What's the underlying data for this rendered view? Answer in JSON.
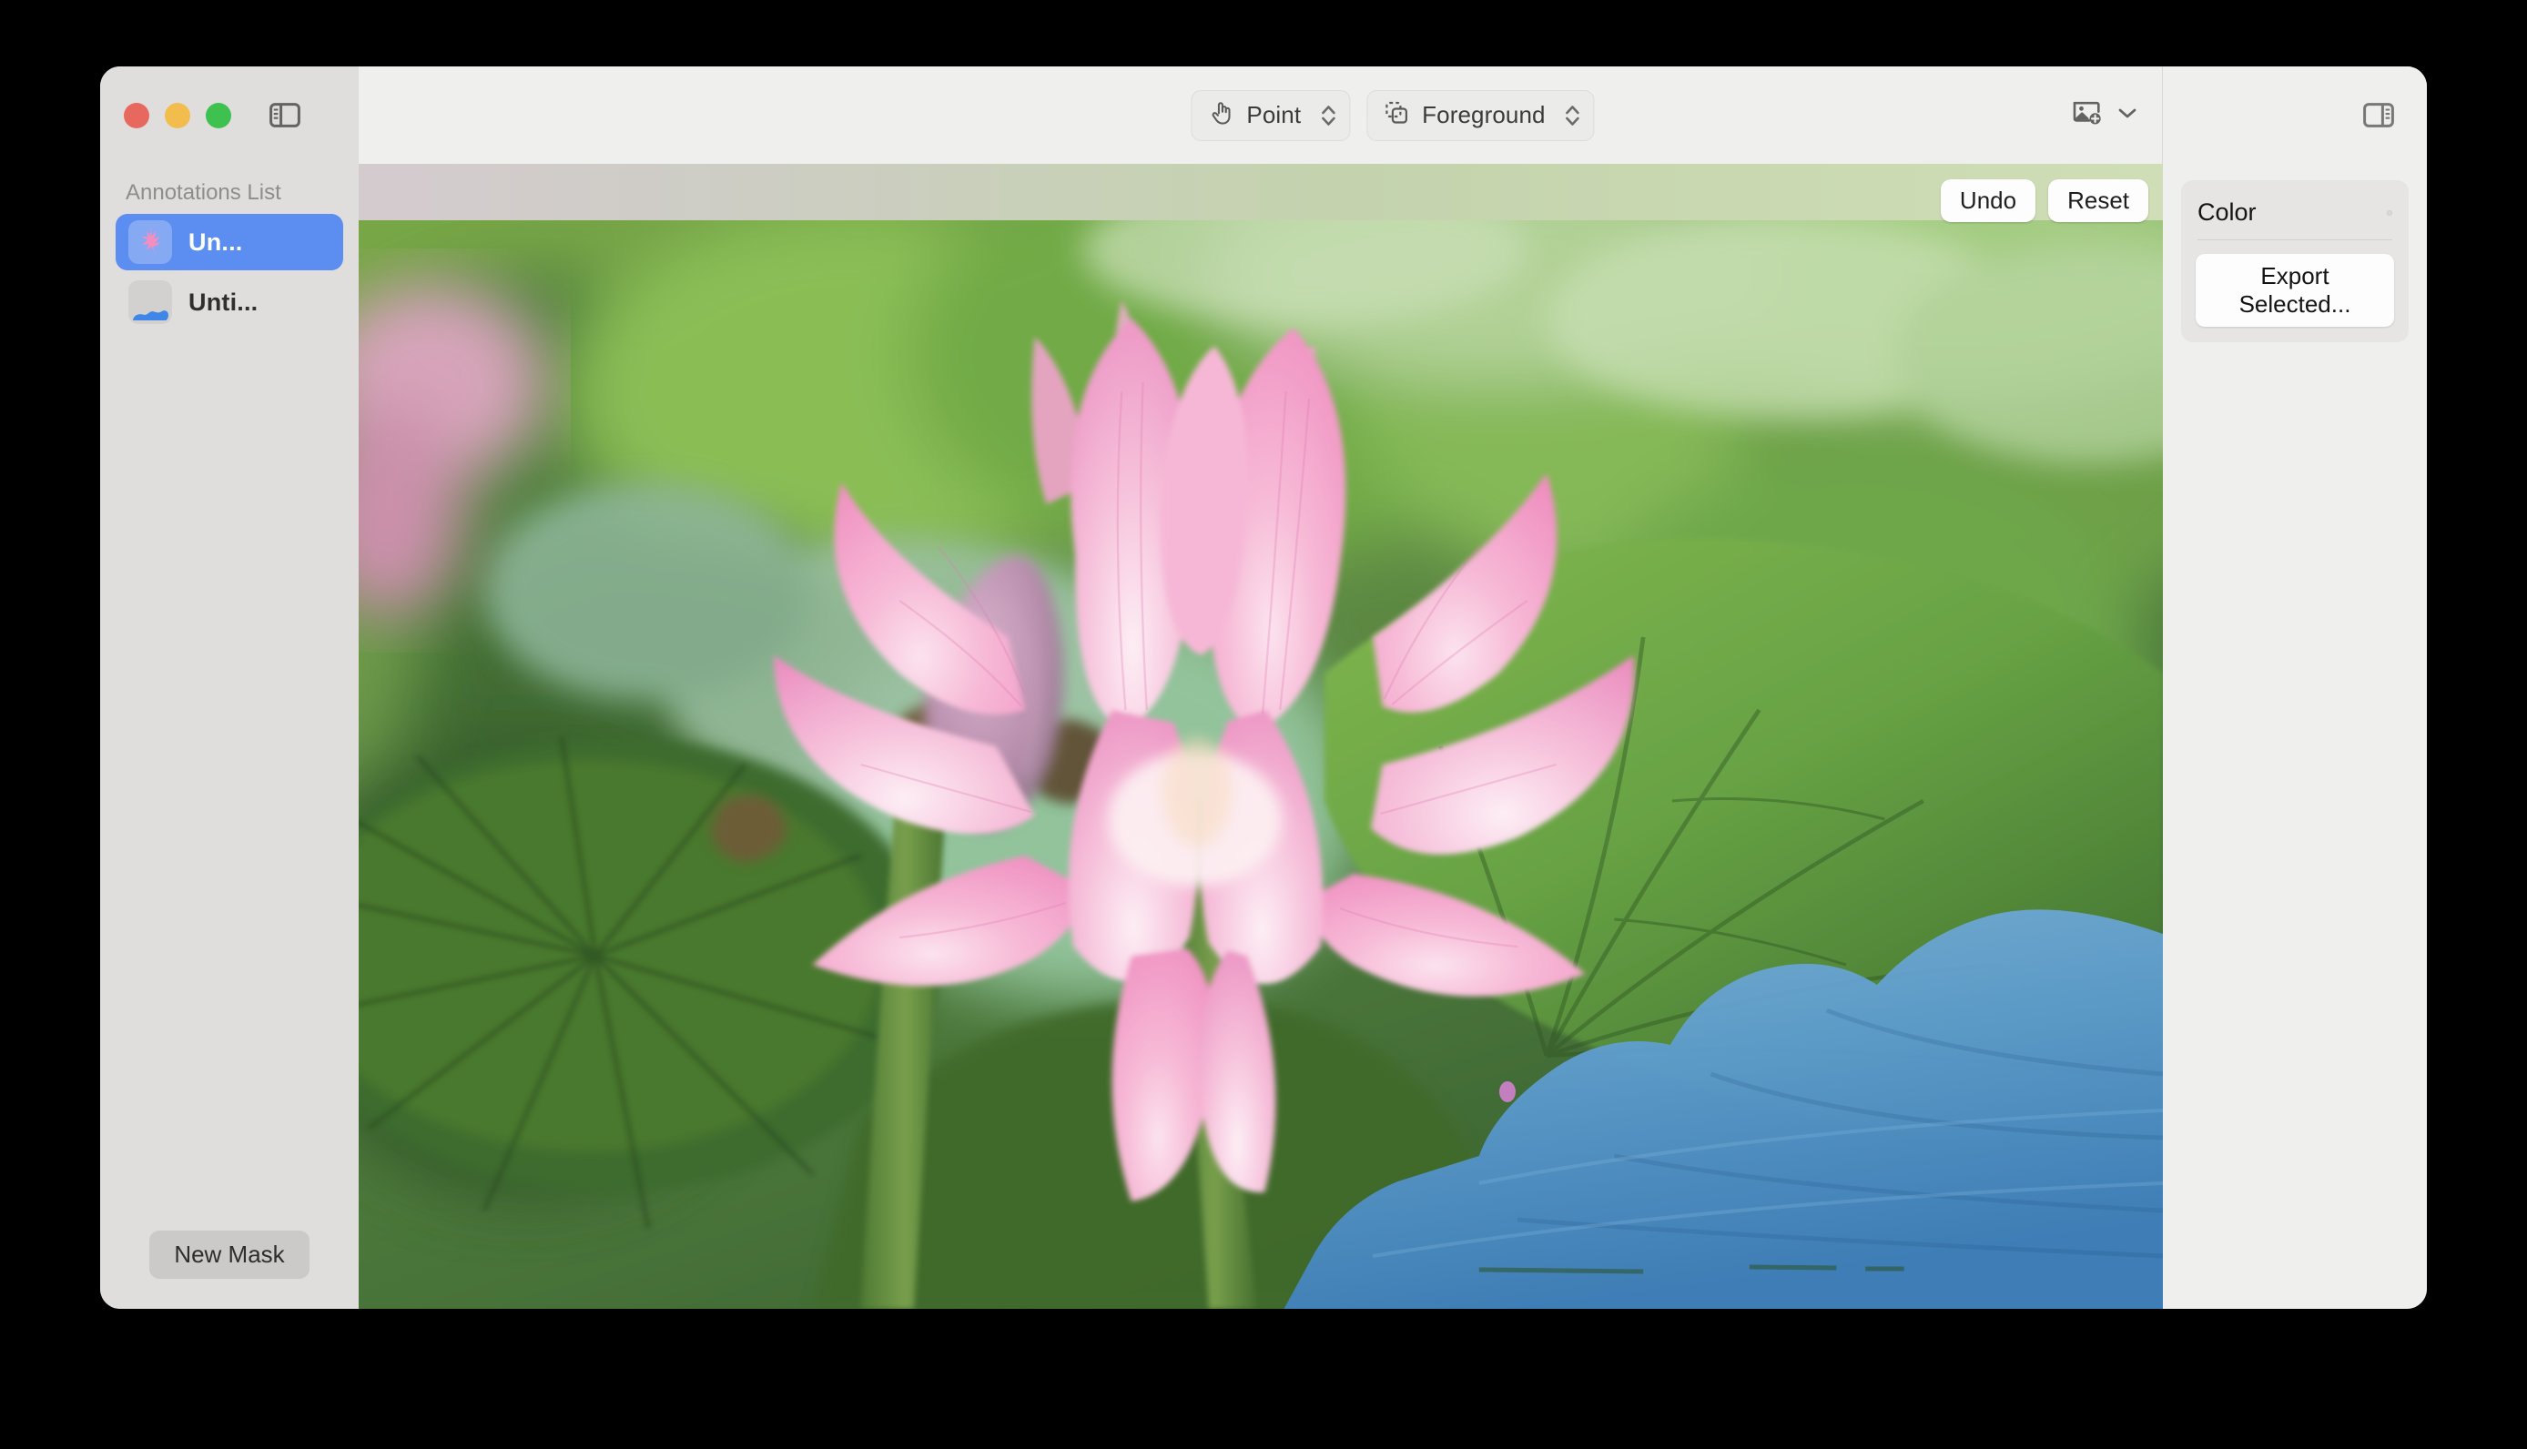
{
  "window": {
    "traffic_lights": [
      "close",
      "minimize",
      "zoom"
    ],
    "left_sidebar_toggle_icon": "sidebar-left-icon",
    "right_sidebar_toggle_icon": "sidebar-right-icon"
  },
  "toolbar": {
    "mode_popup": {
      "icon": "hand-point-icon",
      "value": "Point",
      "stepper_icon": "up-down-chevron-icon"
    },
    "layer_popup": {
      "icon": "foreground-layers-icon",
      "value": "Foreground",
      "stepper_icon": "up-down-chevron-icon"
    },
    "add_image": {
      "icon": "add-image-icon",
      "chevron_icon": "chevron-down-icon"
    }
  },
  "sidebar": {
    "title": "Annotations List",
    "items": [
      {
        "label": "Un...",
        "thumbnail": "pink-flower-mask-thumb",
        "selected": true
      },
      {
        "label": "Unti...",
        "thumbnail": "blue-leaf-mask-thumb",
        "selected": false
      }
    ],
    "new_mask_label": "New Mask"
  },
  "canvas": {
    "undo_label": "Undo",
    "reset_label": "Reset",
    "image_subject": "pink lotus flower with green lily pads",
    "mask_overlay_color": "#3f86cc",
    "point_marker_color": "#c07cc0"
  },
  "inspector": {
    "color_label": "Color",
    "color_value": "#f78cc8",
    "export_label": "Export Selected..."
  },
  "colors": {
    "window_bg": "#ececec",
    "sidebar_bg": "#e0dedd",
    "toolbar_bg": "#efefee",
    "selection_blue": "#5b8ef0",
    "accent_pink": "#f78cc8"
  }
}
